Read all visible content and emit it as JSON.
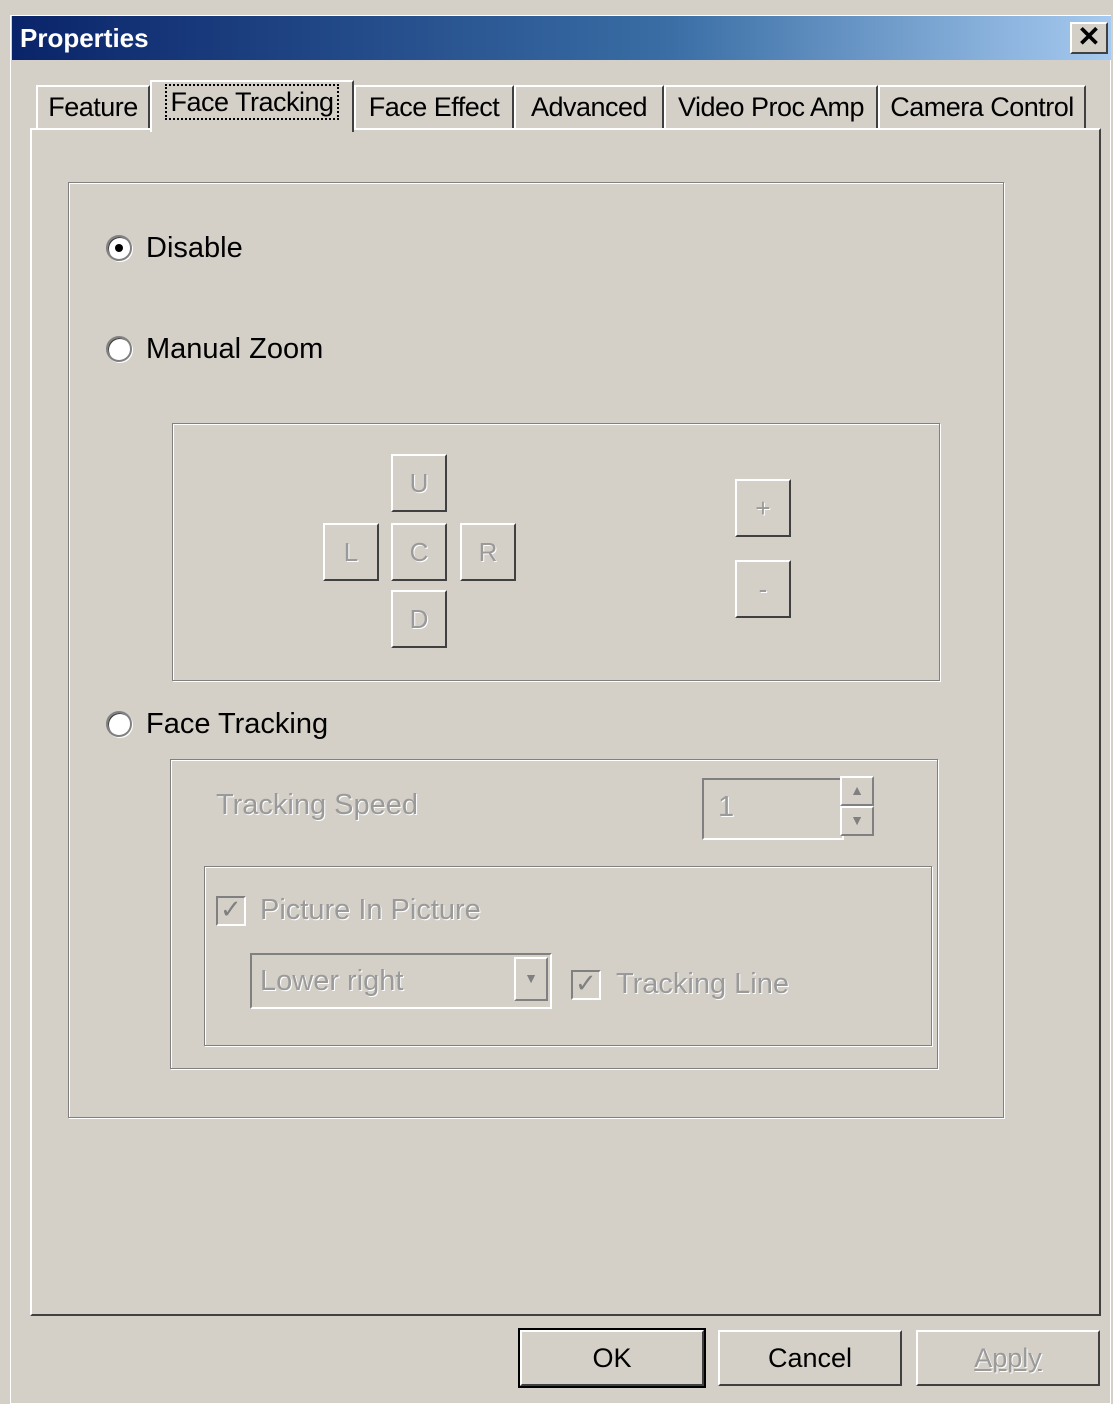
{
  "window": {
    "title": "Properties",
    "close_glyph": "✕"
  },
  "tabs": [
    {
      "label": "Feature",
      "active": false
    },
    {
      "label": "Face Tracking",
      "active": true
    },
    {
      "label": "Face Effect",
      "active": false
    },
    {
      "label": "Advanced",
      "active": false
    },
    {
      "label": "Video Proc Amp",
      "active": false
    },
    {
      "label": "Camera Control",
      "active": false
    }
  ],
  "mode": {
    "selected": "Disable",
    "options": [
      "Disable",
      "Manual Zoom",
      "Face Tracking"
    ]
  },
  "manual_zoom": {
    "up_label": "U",
    "left_label": "L",
    "center_label": "C",
    "right_label": "R",
    "down_label": "D",
    "zoom_in_label": "+",
    "zoom_out_label": "-"
  },
  "face_tracking": {
    "speed_label": "Tracking Speed",
    "speed_value": "1",
    "pip_label": "Picture In Picture",
    "pip_checked": true,
    "pip_position": "Lower right",
    "tracking_line_label": "Tracking Line",
    "tracking_line_checked": true
  },
  "buttons": {
    "ok": "OK",
    "cancel": "Cancel",
    "apply": "Apply"
  },
  "colors": {
    "face": "#d4d0c8",
    "title_start": "#0a246a",
    "title_end": "#a6caf0",
    "disabled_text": "#9a9a9a"
  }
}
